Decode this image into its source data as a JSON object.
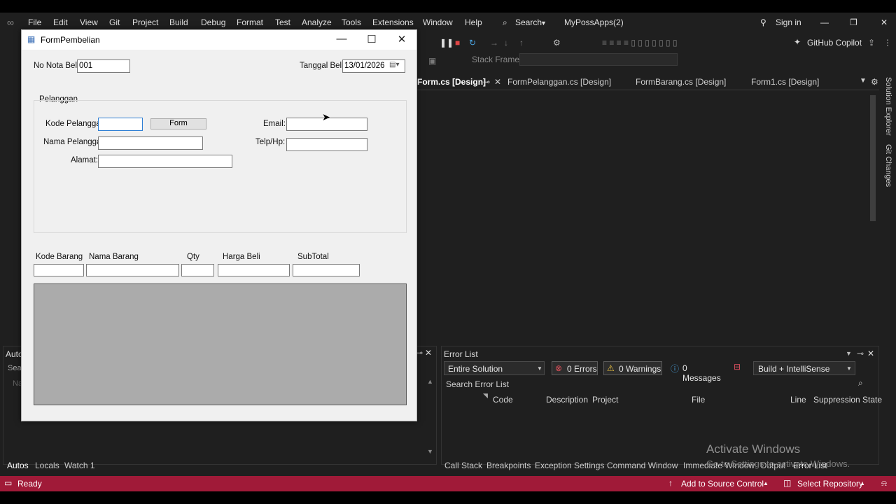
{
  "vs": {
    "menu": [
      "File",
      "Edit",
      "View",
      "Git",
      "Project",
      "Build",
      "Debug",
      "Format",
      "Test",
      "Analyze",
      "Tools",
      "Extensions",
      "Window",
      "Help"
    ],
    "search_label": "Search",
    "solution_name": "MyPossApps(2)",
    "sign_in": "Sign in",
    "copilot": "GitHub Copilot",
    "stack_frame_label": "Stack Frame:",
    "tabs": [
      "Form.cs [Design]",
      "FormPelanggan.cs [Design]",
      "FormBarang.cs [Design]",
      "Form1.cs [Design]"
    ],
    "side_tabs": [
      "Solution Explorer",
      "Git Changes"
    ],
    "left_panel_title": "Auto",
    "left_panel_search": "Sear",
    "left_panel_name": "Na",
    "left_bottom_tabs": [
      "Autos",
      "Locals",
      "Watch 1"
    ],
    "error_list": {
      "title": "Error List",
      "scope": "Entire Solution",
      "errors": "0 Errors",
      "warnings": "0 Warnings",
      "messages": "0 Messages",
      "build_filter": "Build + IntelliSense",
      "search_placeholder": "Search Error List",
      "columns": [
        "Code",
        "Description",
        "Project",
        "File",
        "Line",
        "Suppression State"
      ]
    },
    "bottom_tabs": [
      "Call Stack",
      "Breakpoints",
      "Exception Settings",
      "Command Window",
      "Immediate Window",
      "Output",
      "Error List"
    ],
    "watermark_title": "Activate Windows",
    "watermark_sub": "Go to Settings to activate Windows.",
    "status": {
      "ready": "Ready",
      "source_control": "Add to Source Control",
      "repository": "Select Repository"
    },
    "colors": {
      "status_bar": "#a01a38",
      "ide_bg": "#1f1f1f"
    }
  },
  "form": {
    "title": "FormPembelian",
    "no_nota_label": "No Nota Beli:",
    "no_nota_value": "001",
    "tanggal_label": "Tanggal Beli:",
    "tanggal_value": "13/01/2026",
    "group_title": "Pelanggan",
    "kode_pelanggan_label": "Kode Pelanggan",
    "form_button": "Form",
    "nama_pelanggan_label": "Nama Pelanggan",
    "alamat_label": "Alamat:",
    "email_label": "Email:",
    "telp_label": "Telp/Hp:",
    "item_headers": [
      "Kode Barang",
      "Nama Barang",
      "Qty",
      "Harga Beli",
      "SubTotal"
    ]
  }
}
